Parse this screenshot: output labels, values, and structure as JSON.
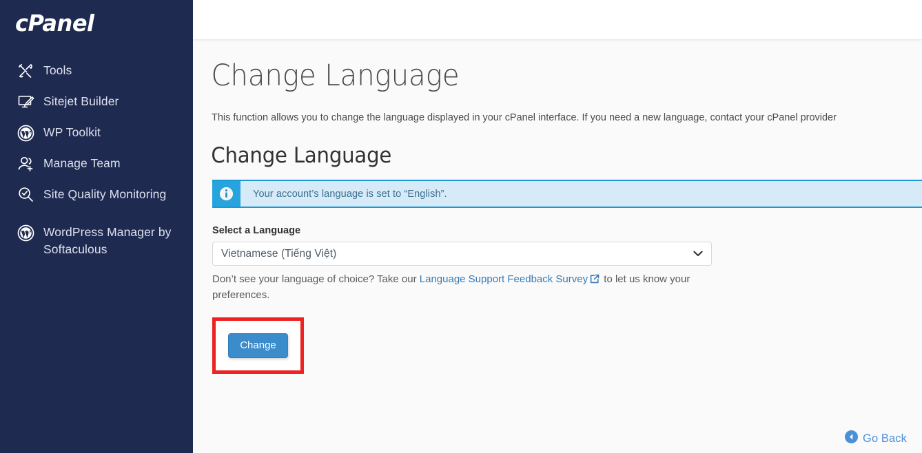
{
  "sidebar": {
    "logo": "cPanel",
    "items": [
      {
        "label": "Tools",
        "icon": "tools-icon"
      },
      {
        "label": "Sitejet Builder",
        "icon": "monitor-pencil-icon"
      },
      {
        "label": "WP Toolkit",
        "icon": "wordpress-icon"
      },
      {
        "label": "Manage Team",
        "icon": "user-add-icon"
      },
      {
        "label": "Site Quality Monitoring",
        "icon": "magnifier-check-icon"
      },
      {
        "label": "WordPress Manager by Softaculous",
        "icon": "wordpress-icon"
      }
    ],
    "background_color": "#1f2a51",
    "label_color": "#dce0ed"
  },
  "page": {
    "title": "Change Language",
    "description": "This function allows you to change the language displayed in your cPanel interface. If you need a new language, contact your cPanel provider",
    "section_title": "Change Language"
  },
  "alert": {
    "type": "info",
    "icon": "info-icon",
    "message": "Your account’s language is set to “English”.",
    "background_color": "#d6eaf8",
    "border_color": "#1b98d5",
    "icon_background_color": "#27a3dd"
  },
  "form": {
    "select_label": "Select a Language",
    "select_value": "Vietnamese (Tiếng Việt)",
    "select_chevron_icon": "chevron-down-icon",
    "help_text_before": "Don’t see your language of choice? Take our ",
    "help_link_text": "Language Support Feedback Survey",
    "help_link_icon": "external-link-icon",
    "help_text_after": " to let us know your preferences.",
    "submit_label": "Change",
    "submit_color": "#3b8ccb"
  },
  "annotation": {
    "highlight_color": "#ee2222",
    "target": "Change"
  },
  "footer": {
    "go_back_label": "Go Back",
    "go_back_icon": "arrow-circle-left-icon",
    "link_color": "#4a90d9"
  }
}
